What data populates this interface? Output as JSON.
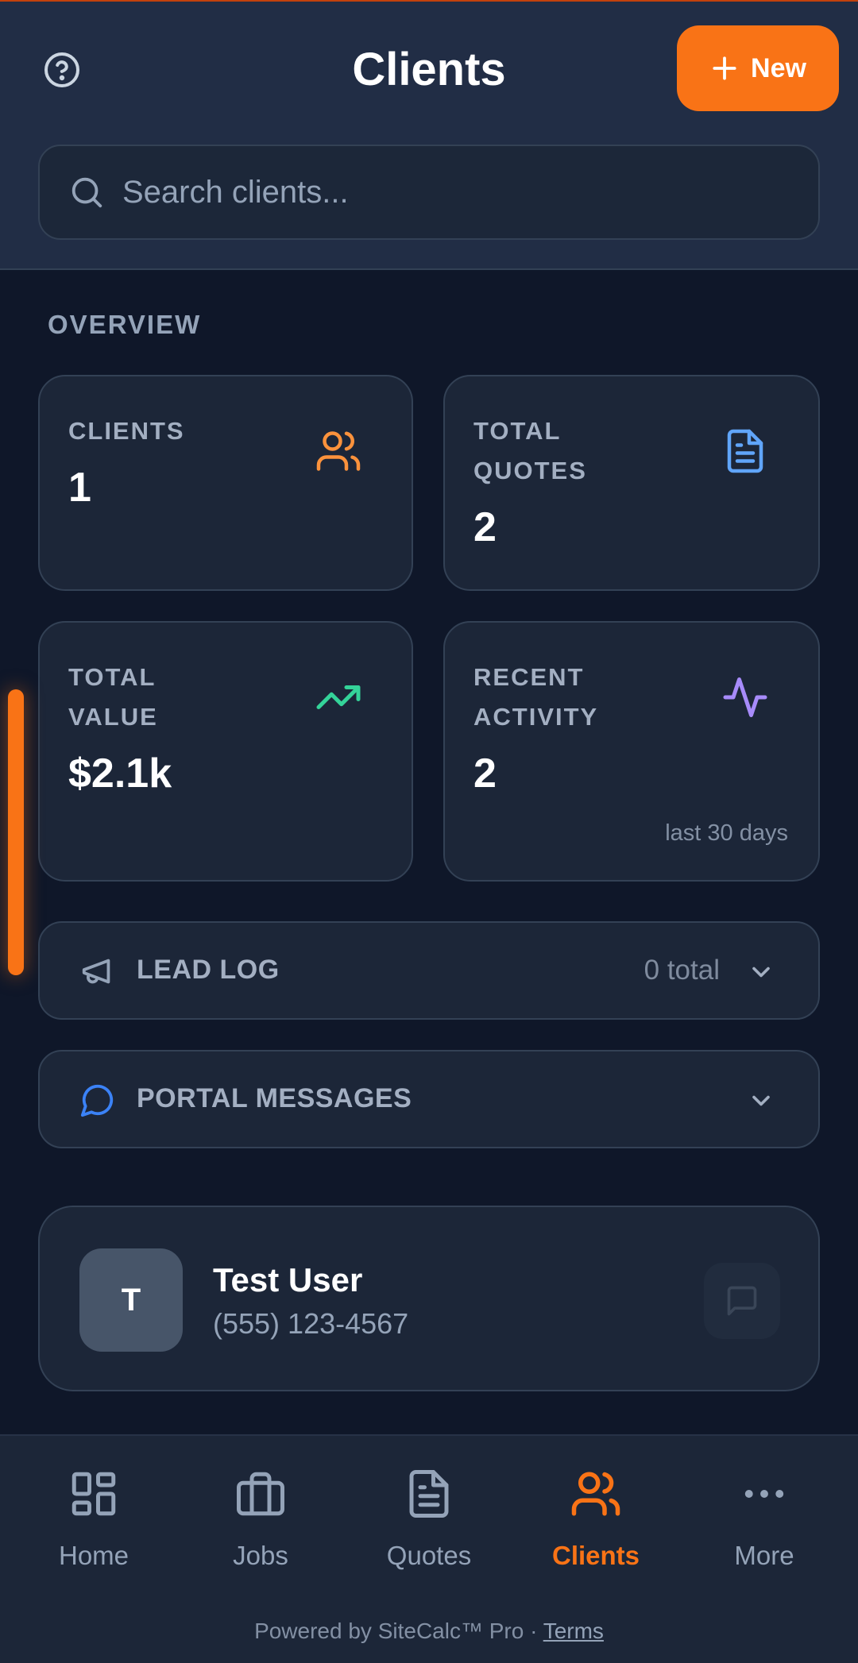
{
  "header": {
    "title": "Clients",
    "new_button_label": "New",
    "search_placeholder": "Search clients..."
  },
  "overview": {
    "section_label": "OVERVIEW",
    "cards": [
      {
        "label": "CLIENTS",
        "value": "1",
        "icon": "users-icon",
        "color": "#fb923c"
      },
      {
        "label": "TOTAL QUOTES",
        "value": "2",
        "icon": "document-icon",
        "color": "#60a5fa"
      },
      {
        "label": "TOTAL VALUE",
        "value": "$2.1k",
        "icon": "trending-up-icon",
        "color": "#34d399"
      },
      {
        "label": "RECENT ACTIVITY",
        "value": "2",
        "sub": "last 30 days",
        "icon": "activity-icon",
        "color": "#a78bfa"
      }
    ]
  },
  "lead_log": {
    "title": "LEAD LOG",
    "count": "0 total"
  },
  "portal_messages": {
    "title": "PORTAL MESSAGES"
  },
  "clients": [
    {
      "initial": "T",
      "name": "Test User",
      "phone": "(555) 123-4567"
    }
  ],
  "nav": {
    "items": [
      {
        "label": "Home",
        "icon": "home-grid-icon"
      },
      {
        "label": "Jobs",
        "icon": "briefcase-icon"
      },
      {
        "label": "Quotes",
        "icon": "document-icon"
      },
      {
        "label": "Clients",
        "icon": "users-icon",
        "active": true
      },
      {
        "label": "More",
        "icon": "more-dots-icon"
      }
    ]
  },
  "footer": {
    "powered_by": "Powered by SiteCalc™ Pro · ",
    "terms": "Terms"
  },
  "colors": {
    "accent": "#f97316",
    "background": "#0f1729",
    "card": "#1c2638"
  }
}
